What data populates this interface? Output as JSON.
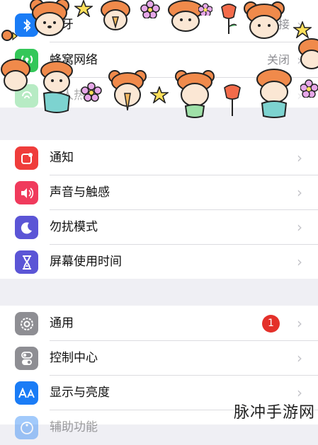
{
  "settings_top": {
    "items": [
      {
        "label": "蓝牙",
        "value": "接",
        "icon": "bluetooth-icon",
        "color": "#1a7cf6"
      },
      {
        "label": "蜂窝网络",
        "value": "关闭",
        "icon": "cellular-icon",
        "color": "#34c759"
      },
      {
        "label": "个人热点",
        "value": "",
        "icon": "hotspot-icon",
        "color": "#34c759"
      }
    ]
  },
  "settings_mid": {
    "items": [
      {
        "label": "通知",
        "icon": "notification-icon",
        "color": "#ef3d3b"
      },
      {
        "label": "声音与触感",
        "icon": "sound-icon",
        "color": "#f03a5c"
      },
      {
        "label": "勿扰模式",
        "icon": "moon-icon",
        "color": "#5b55d6"
      },
      {
        "label": "屏幕使用时间",
        "icon": "hourglass-icon",
        "color": "#5b55d6"
      }
    ]
  },
  "settings_bottom": {
    "items": [
      {
        "label": "通用",
        "icon": "gear-icon",
        "color": "#8e8e93",
        "badge": "1"
      },
      {
        "label": "控制中心",
        "icon": "toggles-icon",
        "color": "#8e8e93"
      },
      {
        "label": "显示与亮度",
        "icon": "aa-display-icon",
        "color": "#1a7cf6"
      },
      {
        "label": "辅助功能",
        "icon": "accessibility-icon",
        "color": "#1a7cf6"
      }
    ]
  },
  "chevron": "›",
  "watermark": "脉冲手游网"
}
